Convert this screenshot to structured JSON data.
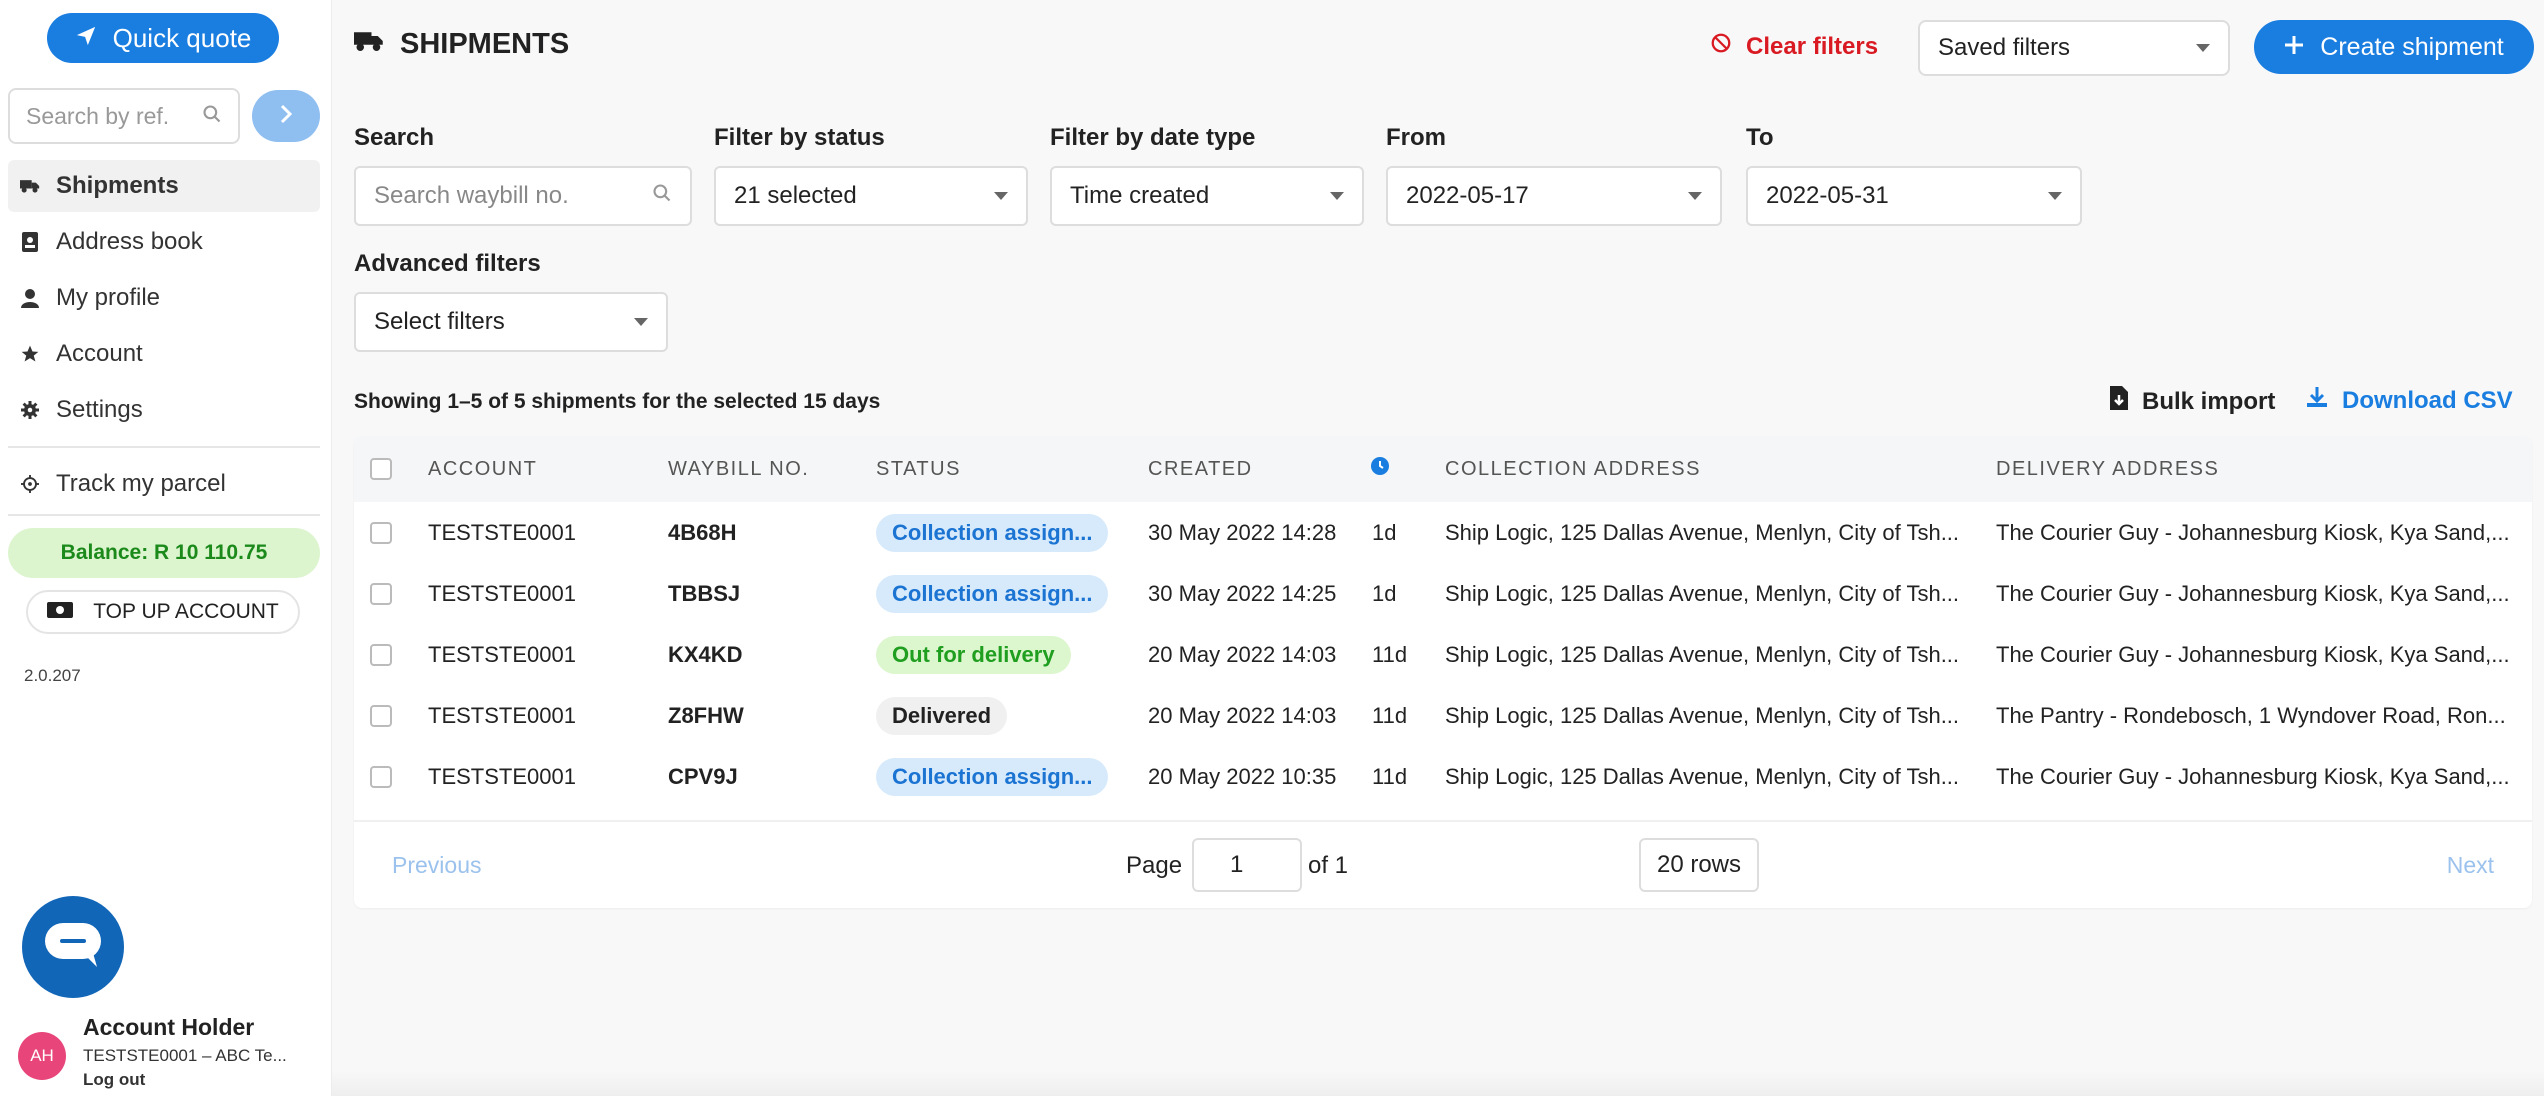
{
  "sidebar": {
    "quote_label": "Quick quote",
    "search_placeholder": "Search by ref.",
    "nav": [
      {
        "label": "Shipments",
        "icon": "truck-icon"
      },
      {
        "label": "Address book",
        "icon": "address-book-icon"
      },
      {
        "label": "My profile",
        "icon": "user-icon"
      },
      {
        "label": "Account",
        "icon": "star-icon"
      },
      {
        "label": "Settings",
        "icon": "gear-icon"
      },
      {
        "label": "Track my parcel",
        "icon": "crosshair-icon"
      }
    ],
    "balance": "Balance: R 10 110.75",
    "topup": "TOP UP ACCOUNT",
    "version": "2.0.207",
    "user": {
      "initials": "AH",
      "name": "Account Holder",
      "account": "TESTSTE0001 – ABC Te...",
      "logout": "Log out"
    }
  },
  "header": {
    "title": "SHIPMENTS",
    "clear_filters": "Clear filters",
    "saved_filters": "Saved filters",
    "create_shipment": "Create shipment"
  },
  "filters": {
    "search_label": "Search",
    "search_placeholder": "Search waybill no.",
    "status_label": "Filter by status",
    "status_value": "21 selected",
    "date_type_label": "Filter by date type",
    "date_type_value": "Time created",
    "from_label": "From",
    "from_value": "2022-05-17",
    "to_label": "To",
    "to_value": "2022-05-31",
    "advanced_label": "Advanced filters",
    "advanced_value": "Select filters"
  },
  "summary": {
    "showing": "Showing 1–5 of 5 shipments for the selected 15 days",
    "bulk_import": "Bulk import",
    "download_csv": "Download CSV"
  },
  "table": {
    "columns": [
      "ACCOUNT",
      "WAYBILL NO.",
      "STATUS",
      "CREATED",
      "COLLECTION ADDRESS",
      "DELIVERY ADDRESS"
    ],
    "rows": [
      {
        "account": "TESTSTE0001",
        "waybill": "4B68H",
        "status": "Collection assign...",
        "status_type": "collection",
        "created": "30 May 2022 14:28",
        "age": "1d",
        "collection": "Ship Logic, 125 Dallas Avenue, Menlyn, City of Tsh...",
        "delivery": "The Courier Guy - Johannesburg Kiosk, Kya Sand,..."
      },
      {
        "account": "TESTSTE0001",
        "waybill": "TBBSJ",
        "status": "Collection assign...",
        "status_type": "collection",
        "created": "30 May 2022 14:25",
        "age": "1d",
        "collection": "Ship Logic, 125 Dallas Avenue, Menlyn, City of Tsh...",
        "delivery": "The Courier Guy - Johannesburg Kiosk, Kya Sand,..."
      },
      {
        "account": "TESTSTE0001",
        "waybill": "KX4KD",
        "status": "Out for delivery",
        "status_type": "delivery",
        "created": "20 May 2022 14:03",
        "age": "11d",
        "collection": "Ship Logic, 125 Dallas Avenue, Menlyn, City of Tsh...",
        "delivery": "The Courier Guy - Johannesburg Kiosk, Kya Sand,..."
      },
      {
        "account": "TESTSTE0001",
        "waybill": "Z8FHW",
        "status": "Delivered",
        "status_type": "delivered",
        "created": "20 May 2022 14:03",
        "age": "11d",
        "collection": "Ship Logic, 125 Dallas Avenue, Menlyn, City of Tsh...",
        "delivery": "The Pantry - Rondebosch, 1 Wyndover Road, Ron..."
      },
      {
        "account": "TESTSTE0001",
        "waybill": "CPV9J",
        "status": "Collection assign...",
        "status_type": "collection",
        "created": "20 May 2022 10:35",
        "age": "11d",
        "collection": "Ship Logic, 125 Dallas Avenue, Menlyn, City of Tsh...",
        "delivery": "The Courier Guy - Johannesburg Kiosk, Kya Sand,..."
      }
    ]
  },
  "pager": {
    "previous": "Previous",
    "page_label": "Page",
    "page_value": "1",
    "of_label": "of 1",
    "rows": "20 rows",
    "next": "Next"
  },
  "colors": {
    "primary": "#1a7de0",
    "danger": "#d91a22",
    "success": "#1f9e1f"
  }
}
